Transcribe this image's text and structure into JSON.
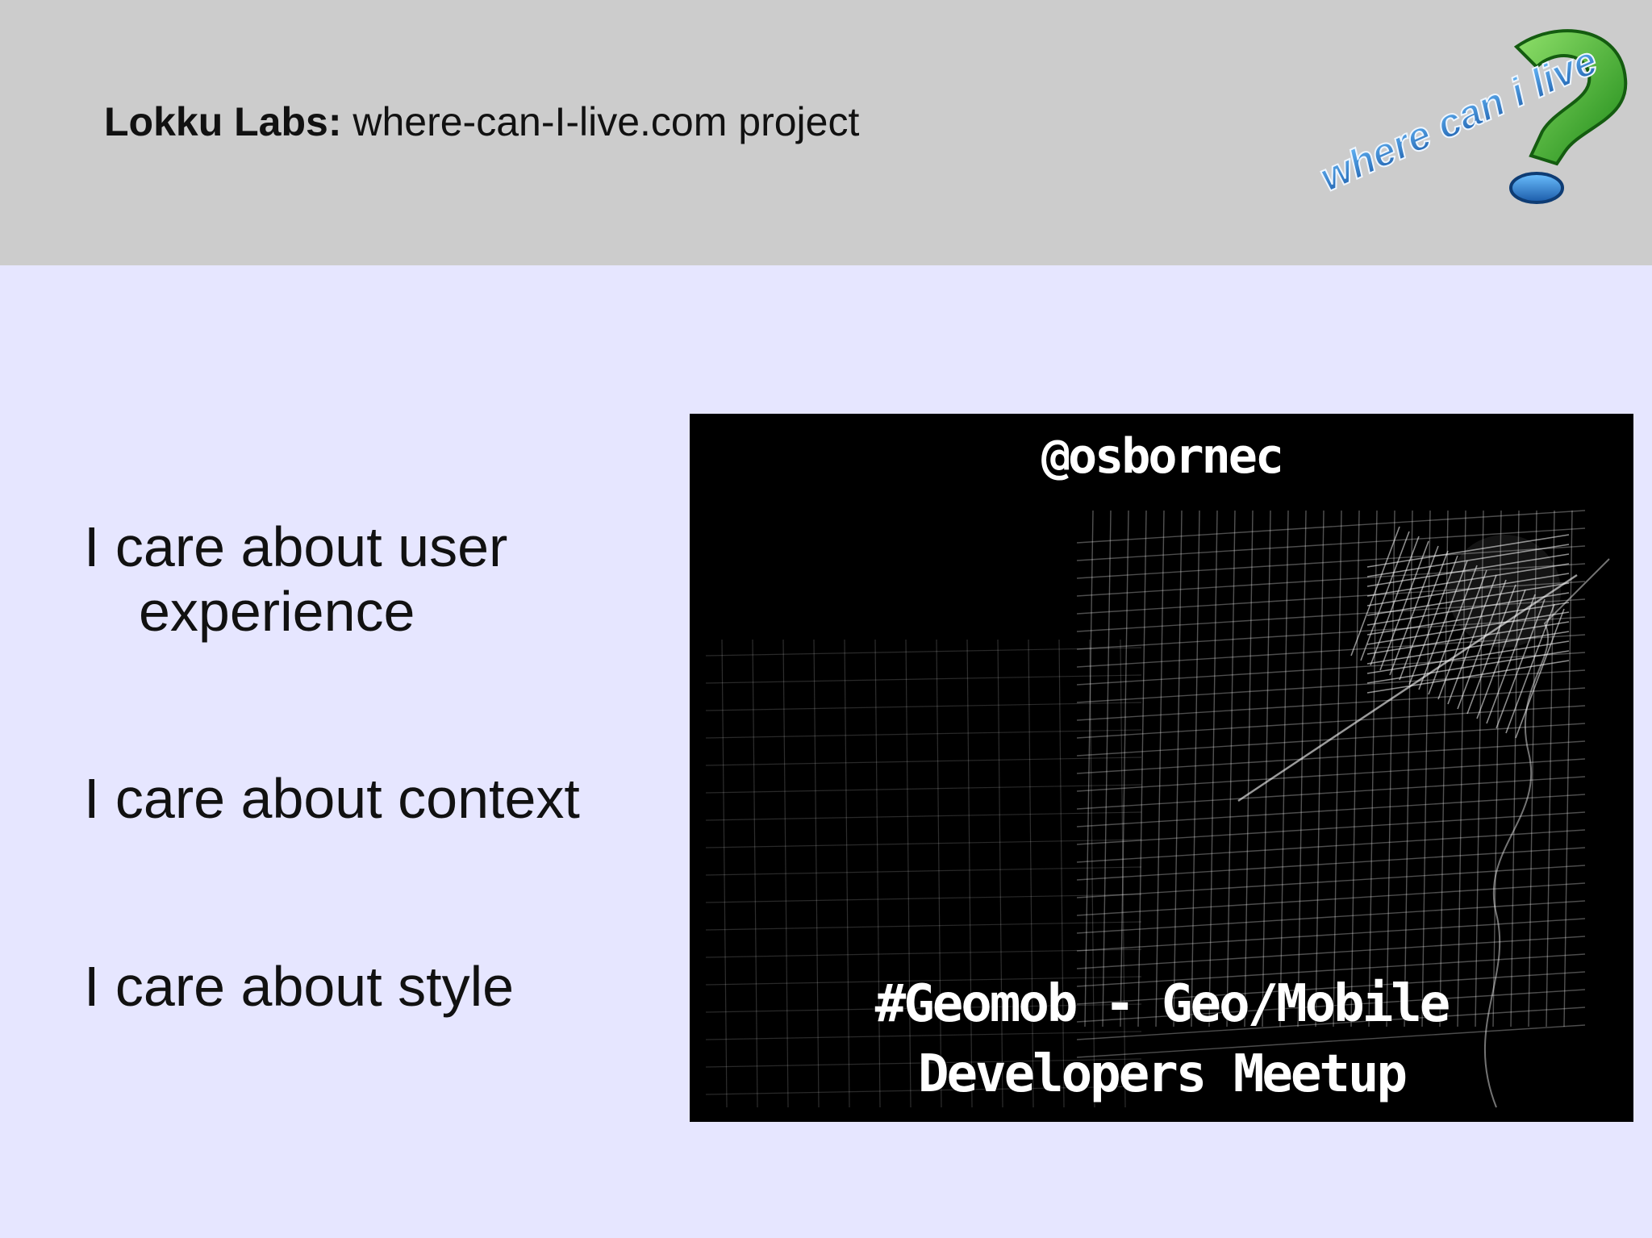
{
  "header": {
    "brand": "Lokku Labs:",
    "project": " where-can-I-live.com project",
    "logo_text": "where can i live",
    "logo_icon": "question-mark-icon"
  },
  "bullets": [
    {
      "line1": "I care about user",
      "line2": "experience"
    },
    {
      "line1": "I care about context"
    },
    {
      "line1": "I care about style"
    }
  ],
  "photo": {
    "handle": "@osbornec",
    "caption_line1": "#Geomob - Geo/Mobile",
    "caption_line2": "Developers Meetup"
  },
  "colors": {
    "header_bg": "#cccccc",
    "slide_bg": "#e6e6ff",
    "logo_green": "#3fae2a",
    "logo_blue": "#2a7fd0"
  }
}
